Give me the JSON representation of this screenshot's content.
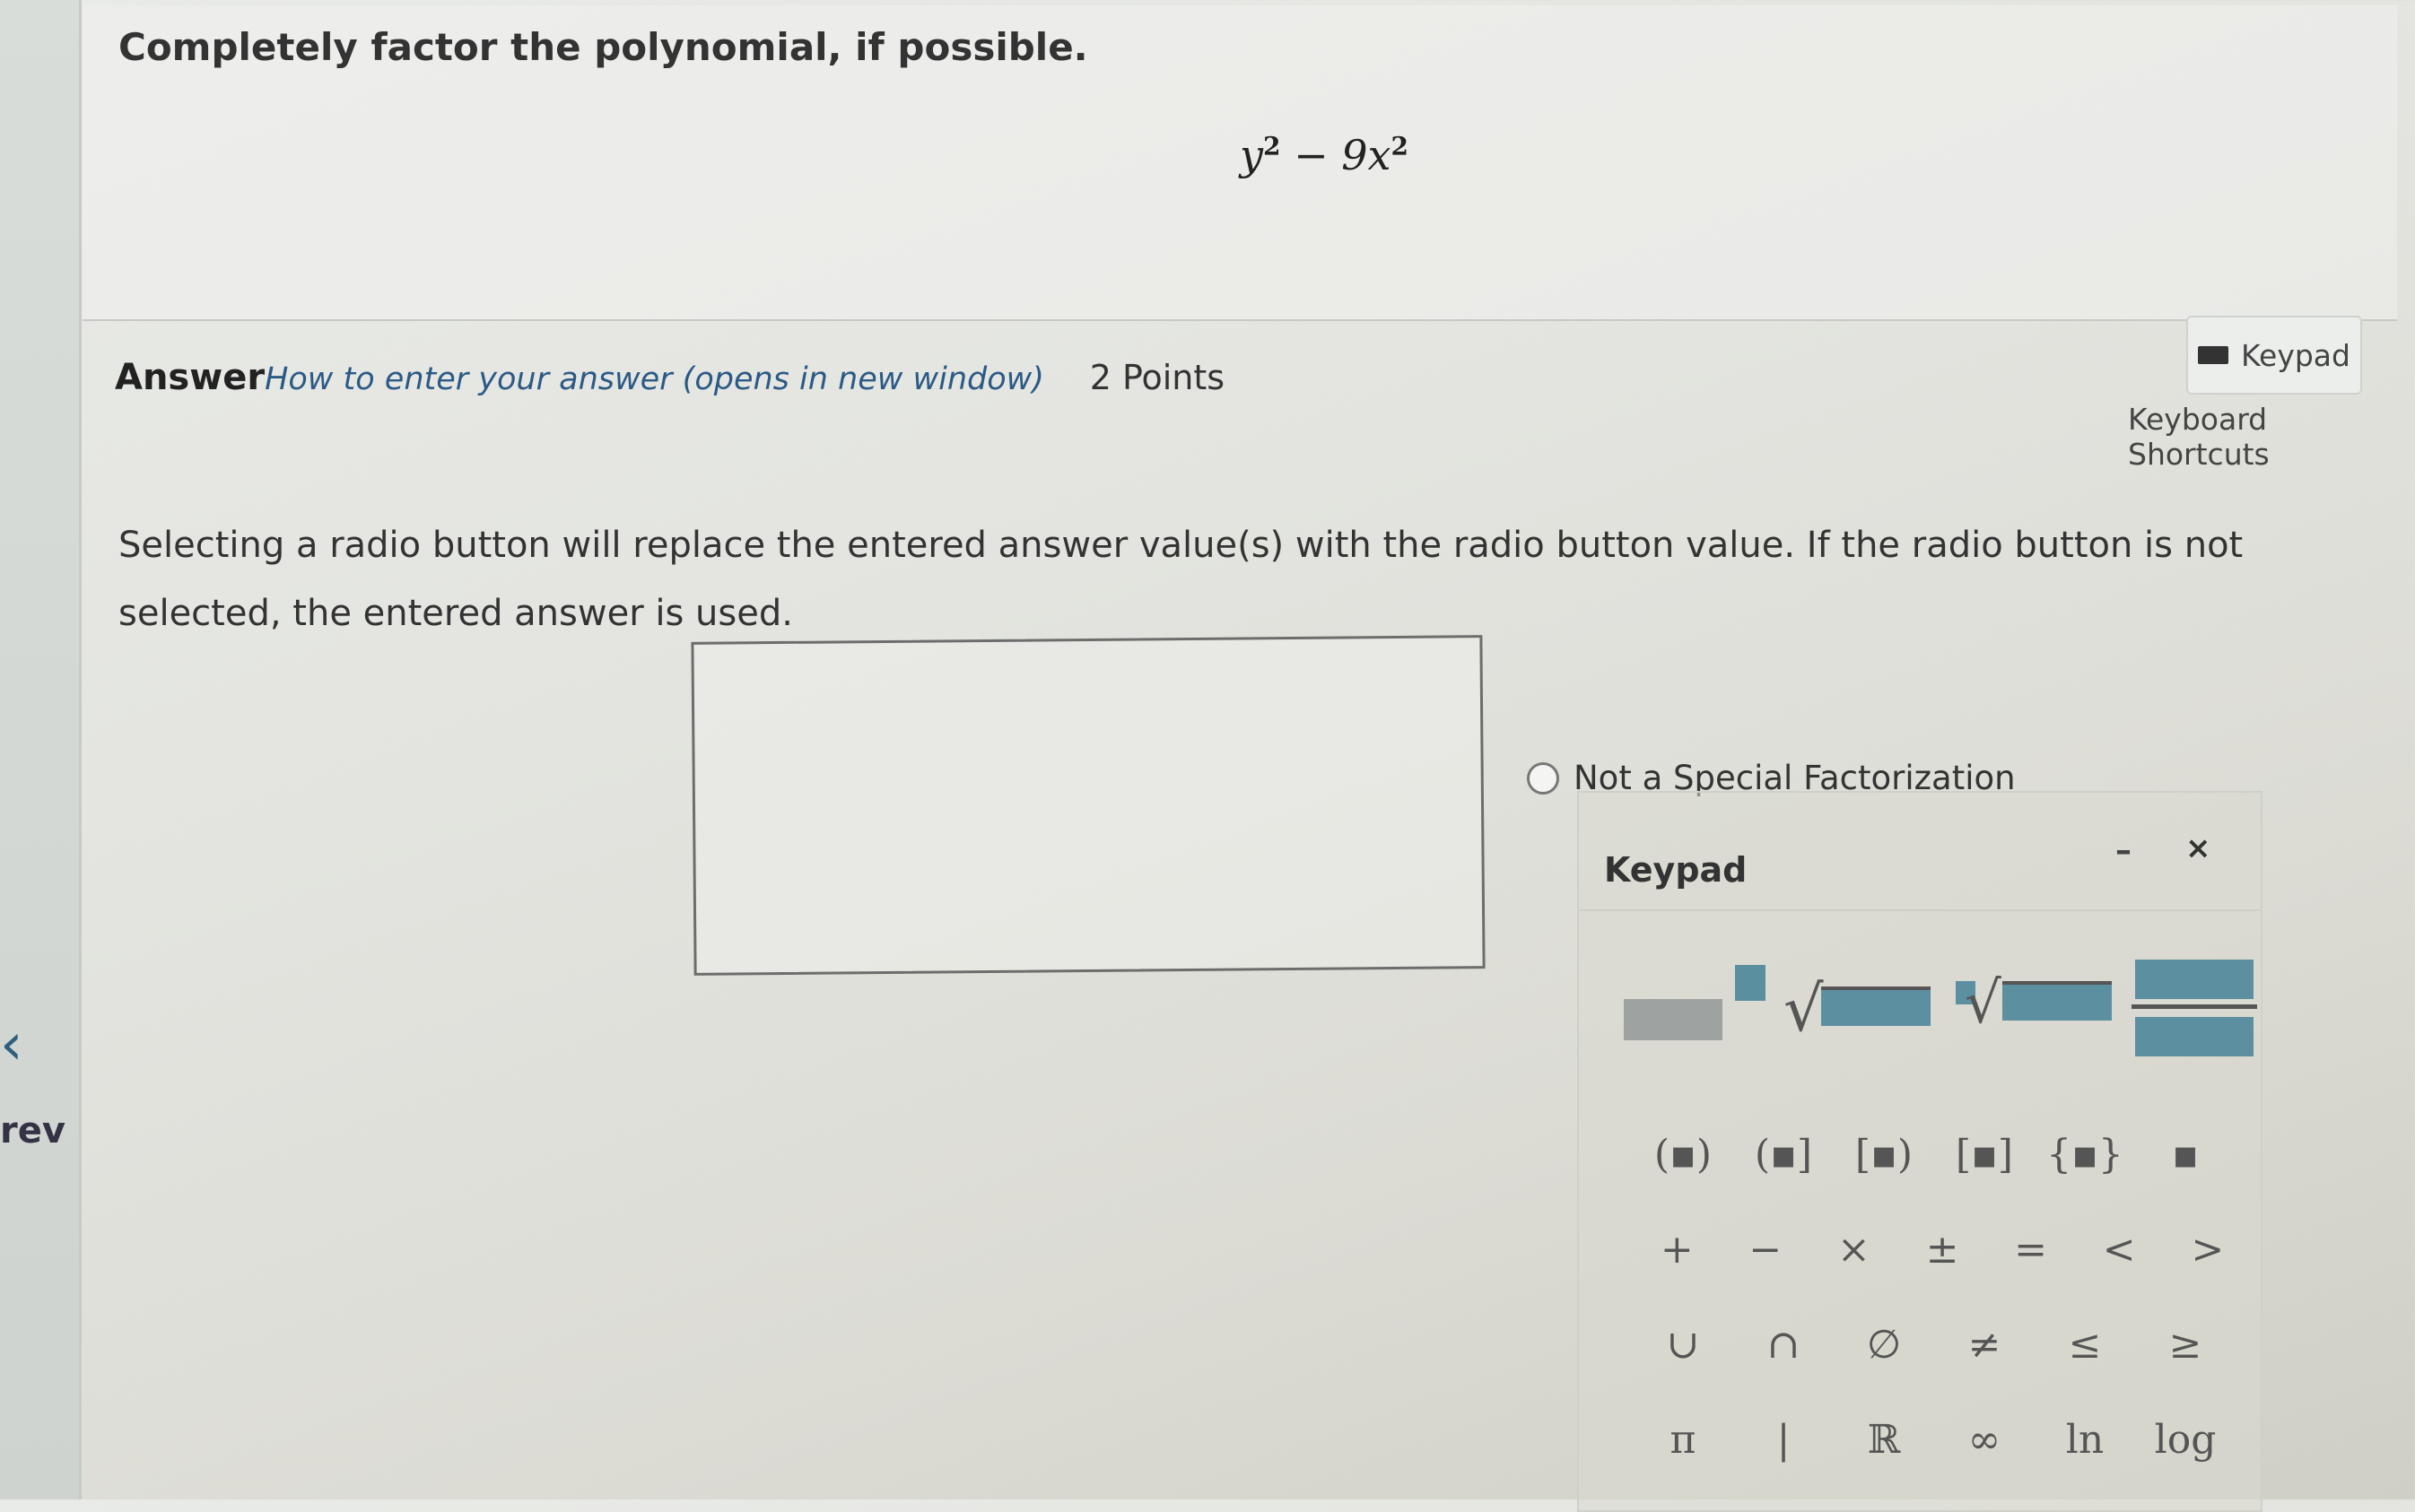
{
  "nav": {
    "prev_label": "rev",
    "prev_chevron": "‹"
  },
  "question": {
    "prompt": "Completely factor the polynomial, if possible.",
    "poly_term1": "y",
    "poly_exp1": "2",
    "poly_op": " − 9",
    "poly_term2": "x",
    "poly_exp2": "2"
  },
  "answer": {
    "label": "Answer",
    "how_link": "How to enter your answer (opens in new window)",
    "points": "2 Points",
    "instructions": "Selecting a radio button will replace the entered answer value(s) with the radio button value. If the radio button is not selected, the entered answer is used.",
    "radio_label": "Not a Special Factorization"
  },
  "toolbar": {
    "keypad_label": "Keypad",
    "shortcuts_label": "Keyboard Shortcuts"
  },
  "keypad": {
    "title": "Keypad",
    "minimize": "–",
    "close": "×",
    "rows": [
      [
        "(▪)",
        "(▪]",
        "[▪)",
        "[▪]",
        "{▪}",
        "▪"
      ],
      [
        "+",
        "−",
        "×",
        "±",
        "=",
        "<",
        ">"
      ],
      [
        "∪",
        "∩",
        "∅",
        "≠",
        "≤",
        "≥"
      ],
      [
        "π",
        "|",
        "ℝ",
        "∞",
        "ln",
        "log"
      ]
    ]
  }
}
